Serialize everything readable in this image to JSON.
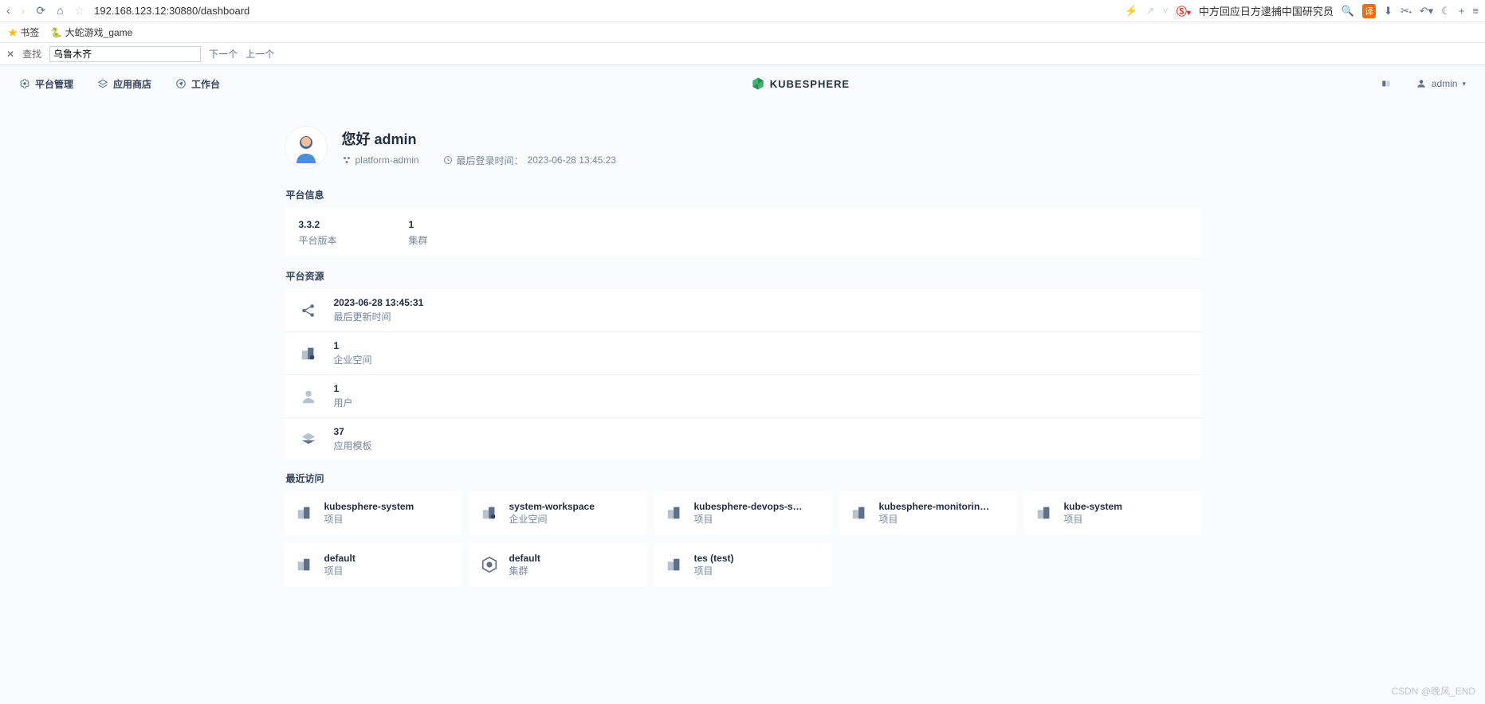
{
  "browser": {
    "url": "192.168.123.12:30880/dashboard",
    "news_text": "中方回应日方逮捕中国研究员",
    "translate_badge": "译"
  },
  "bookmarks": {
    "label": "书签",
    "item1": "大蛇游戏_game"
  },
  "find": {
    "label": "查找",
    "value": "乌鲁木齐",
    "next": "下一个",
    "prev": "上一个"
  },
  "topnav": {
    "platform": "平台管理",
    "appstore": "应用商店",
    "workbench": "工作台",
    "logo": "KUBESPHERE",
    "user": "admin"
  },
  "hello": {
    "title": "您好 admin",
    "role": "platform-admin",
    "lastlogin_label": "最后登录时间：",
    "lastlogin_time": "2023-06-28 13:45:23"
  },
  "sections": {
    "platform_info": "平台信息",
    "platform_resources": "平台资源",
    "recent": "最近访问"
  },
  "platform_info": {
    "version_val": "3.3.2",
    "version_lbl": "平台版本",
    "cluster_val": "1",
    "cluster_lbl": "集群"
  },
  "resources": [
    {
      "val": "2023-06-28 13:45:31",
      "lbl": "最后更新时间",
      "icon": "share"
    },
    {
      "val": "1",
      "lbl": "企业空间",
      "icon": "workspace"
    },
    {
      "val": "1",
      "lbl": "用户",
      "icon": "user"
    },
    {
      "val": "37",
      "lbl": "应用模板",
      "icon": "template"
    }
  ],
  "recent": [
    {
      "title": "kubesphere-system",
      "sub": "项目",
      "icon": "project"
    },
    {
      "title": "system-workspace",
      "sub": "企业空间",
      "icon": "workspace"
    },
    {
      "title": "kubesphere-devops-system",
      "sub": "项目",
      "icon": "project"
    },
    {
      "title": "kubesphere-monitoring-federat...",
      "sub": "项目",
      "icon": "project"
    },
    {
      "title": "kube-system",
      "sub": "项目",
      "icon": "project"
    },
    {
      "title": "default",
      "sub": "项目",
      "icon": "project"
    },
    {
      "title": "default",
      "sub": "集群",
      "icon": "cluster"
    },
    {
      "title": "tes (test)",
      "sub": "项目",
      "icon": "project"
    }
  ],
  "watermark": "CSDN @晚风_END"
}
